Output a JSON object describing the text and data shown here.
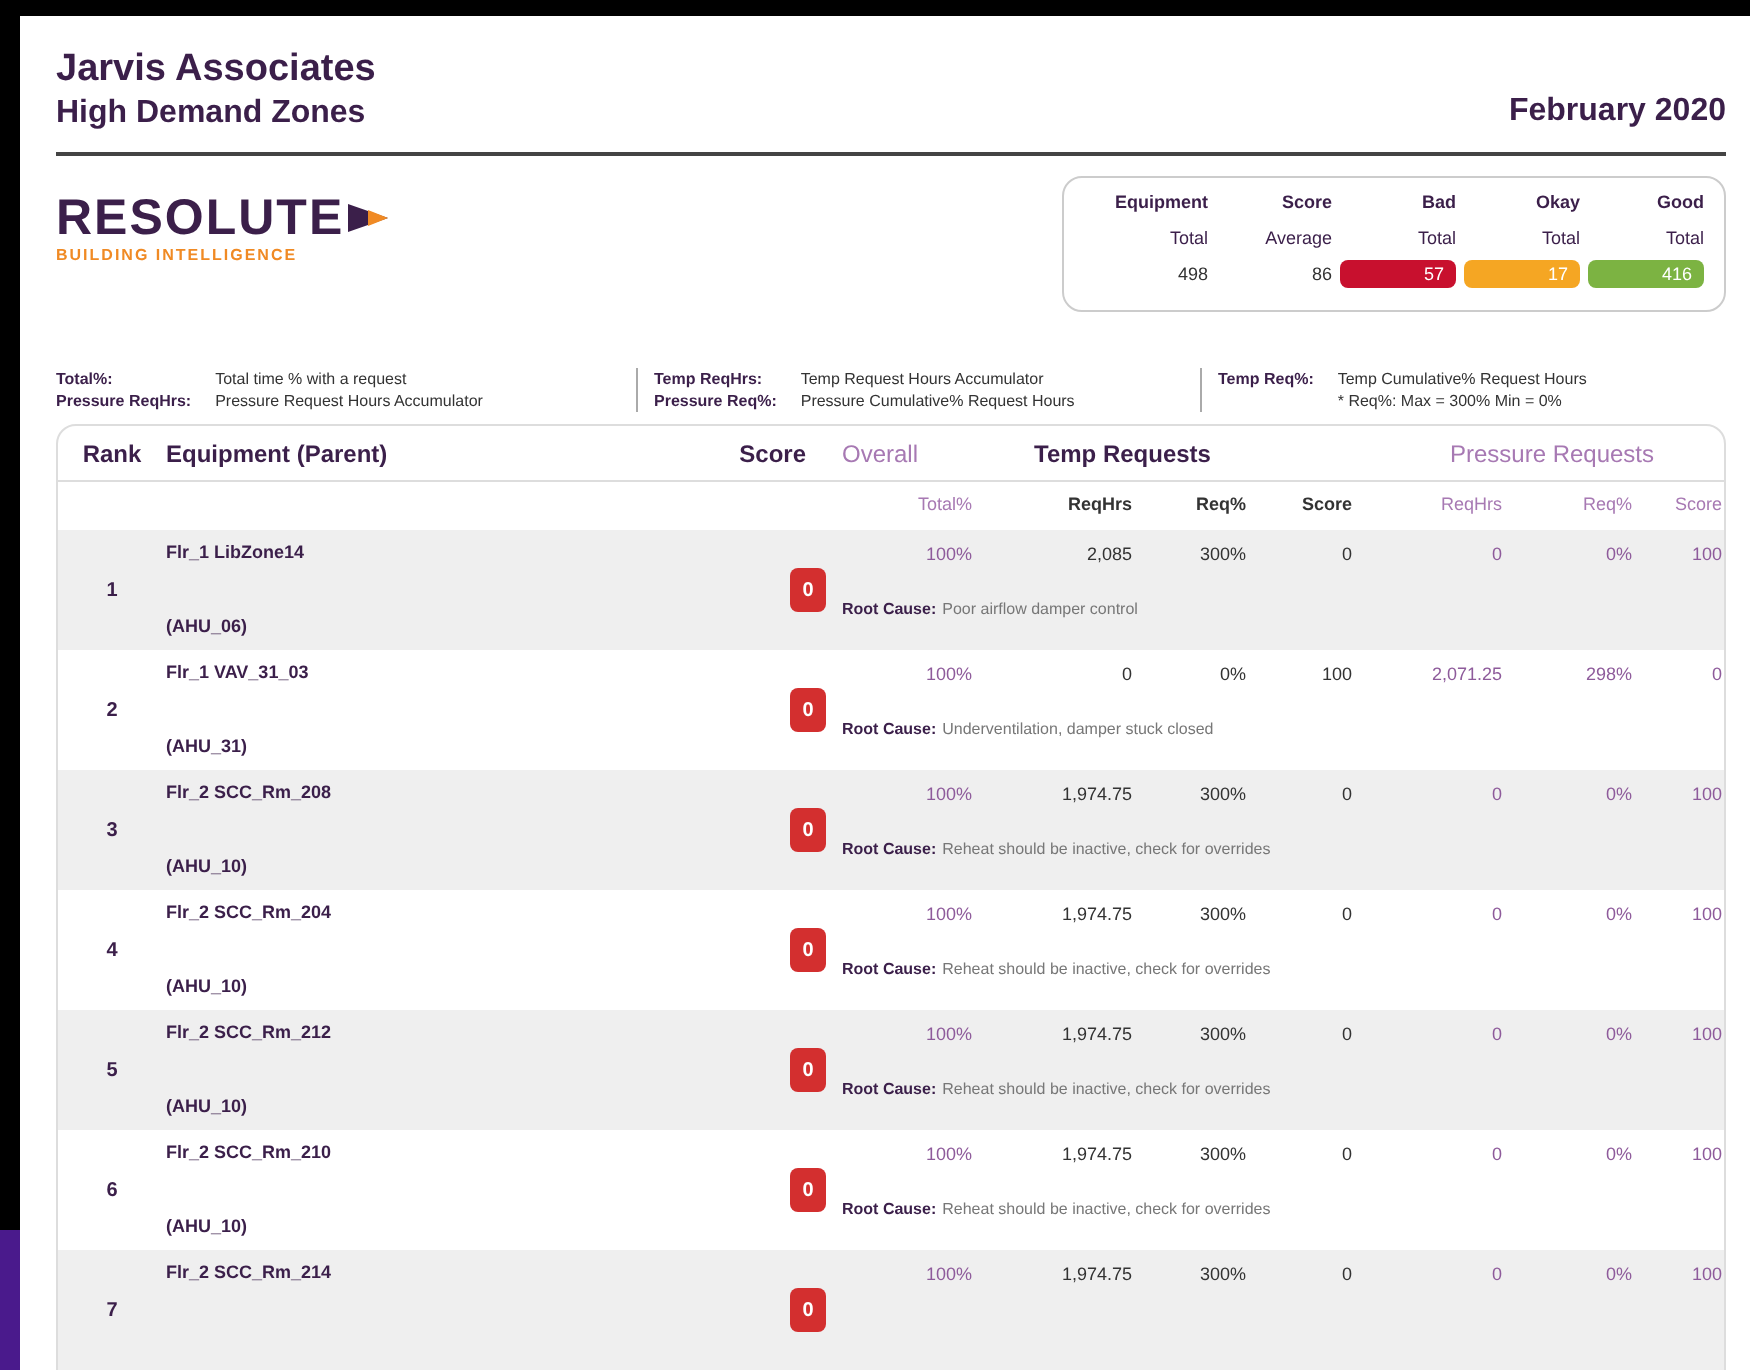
{
  "header": {
    "company": "Jarvis Associates",
    "report": "High Demand Zones",
    "period": "February 2020"
  },
  "logo": {
    "name": "RESOLUTE",
    "tagline": "BUILDING INTELLIGENCE"
  },
  "summary": [
    {
      "label": "Equipment",
      "sublabel": "Total",
      "value": "498",
      "kind": "plain"
    },
    {
      "label": "Score",
      "sublabel": "Average",
      "value": "86",
      "kind": "plain"
    },
    {
      "label": "Bad",
      "sublabel": "Total",
      "value": "57",
      "kind": "badge",
      "color": "#c8102e"
    },
    {
      "label": "Okay",
      "sublabel": "Total",
      "value": "17",
      "kind": "badge",
      "color": "#f5a623"
    },
    {
      "label": "Good",
      "sublabel": "Total",
      "value": "416",
      "kind": "badge",
      "color": "#7cb342"
    }
  ],
  "legend": [
    [
      {
        "term": "Total%:",
        "definition": "Total time % with a request"
      },
      {
        "term": "Pressure ReqHrs:",
        "definition": "Pressure Request Hours Accumulator"
      }
    ],
    [
      {
        "term": "Temp ReqHrs:",
        "definition": "Temp Request Hours Accumulator"
      },
      {
        "term": "Pressure Req%:",
        "definition": "Pressure Cumulative% Request Hours"
      }
    ],
    [
      {
        "term": "Temp Req%:",
        "definition": "Temp Cumulative% Request Hours"
      }
    ]
  ],
  "legend_note": "* Req%: Max = 300% Min = 0%",
  "table": {
    "columns": [
      "Rank",
      "Equipment (Parent)",
      "Score"
    ],
    "groups": [
      {
        "label": "Overall",
        "kind": "overall"
      },
      {
        "label": "Temp Requests",
        "kind": "temp"
      },
      {
        "label": "Pressure Requests",
        "kind": "pressure"
      }
    ],
    "subcolumns": [
      {
        "label": "Total%",
        "kind": "overall"
      },
      {
        "label": "ReqHrs",
        "kind": "temp"
      },
      {
        "label": "Req%",
        "kind": "temp"
      },
      {
        "label": "Score",
        "kind": "temp"
      },
      {
        "label": "ReqHrs",
        "kind": "pressure"
      },
      {
        "label": "Req%",
        "kind": "pressure"
      },
      {
        "label": "Score",
        "kind": "pressure"
      }
    ],
    "rows": [
      {
        "rank": "1",
        "equipment": "Flr_1 LibZone14",
        "parent": "(AHU_06)",
        "score": "0",
        "values": [
          "100%",
          "2,085",
          "300%",
          "0",
          "0",
          "0%",
          "100"
        ],
        "root_cause_label": "Root Cause:",
        "root_cause": "Poor airflow damper control"
      },
      {
        "rank": "2",
        "equipment": "Flr_1 VAV_31_03",
        "parent": "(AHU_31)",
        "score": "0",
        "values": [
          "100%",
          "0",
          "0%",
          "100",
          "2,071.25",
          "298%",
          "0"
        ],
        "root_cause_label": "Root Cause:",
        "root_cause": "Underventilation, damper stuck closed"
      },
      {
        "rank": "3",
        "equipment": "Flr_2 SCC_Rm_208",
        "parent": "(AHU_10)",
        "score": "0",
        "values": [
          "100%",
          "1,974.75",
          "300%",
          "0",
          "0",
          "0%",
          "100"
        ],
        "root_cause_label": "Root Cause:",
        "root_cause": "Reheat should be inactive, check for overrides"
      },
      {
        "rank": "4",
        "equipment": "Flr_2 SCC_Rm_204",
        "parent": "(AHU_10)",
        "score": "0",
        "values": [
          "100%",
          "1,974.75",
          "300%",
          "0",
          "0",
          "0%",
          "100"
        ],
        "root_cause_label": "Root Cause:",
        "root_cause": "Reheat should be inactive, check for overrides"
      },
      {
        "rank": "5",
        "equipment": "Flr_2 SCC_Rm_212",
        "parent": "(AHU_10)",
        "score": "0",
        "values": [
          "100%",
          "1,974.75",
          "300%",
          "0",
          "0",
          "0%",
          "100"
        ],
        "root_cause_label": "Root Cause:",
        "root_cause": "Reheat should be inactive, check for overrides"
      },
      {
        "rank": "6",
        "equipment": "Flr_2 SCC_Rm_210",
        "parent": "(AHU_10)",
        "score": "0",
        "values": [
          "100%",
          "1,974.75",
          "300%",
          "0",
          "0",
          "0%",
          "100"
        ],
        "root_cause_label": "Root Cause:",
        "root_cause": "Reheat should be inactive, check for overrides"
      },
      {
        "rank": "7",
        "equipment": "Flr_2 SCC_Rm_214",
        "score": "0",
        "values": [
          "100%",
          "1,974.75",
          "300%",
          "0",
          "0",
          "0%",
          "100"
        ]
      }
    ]
  }
}
